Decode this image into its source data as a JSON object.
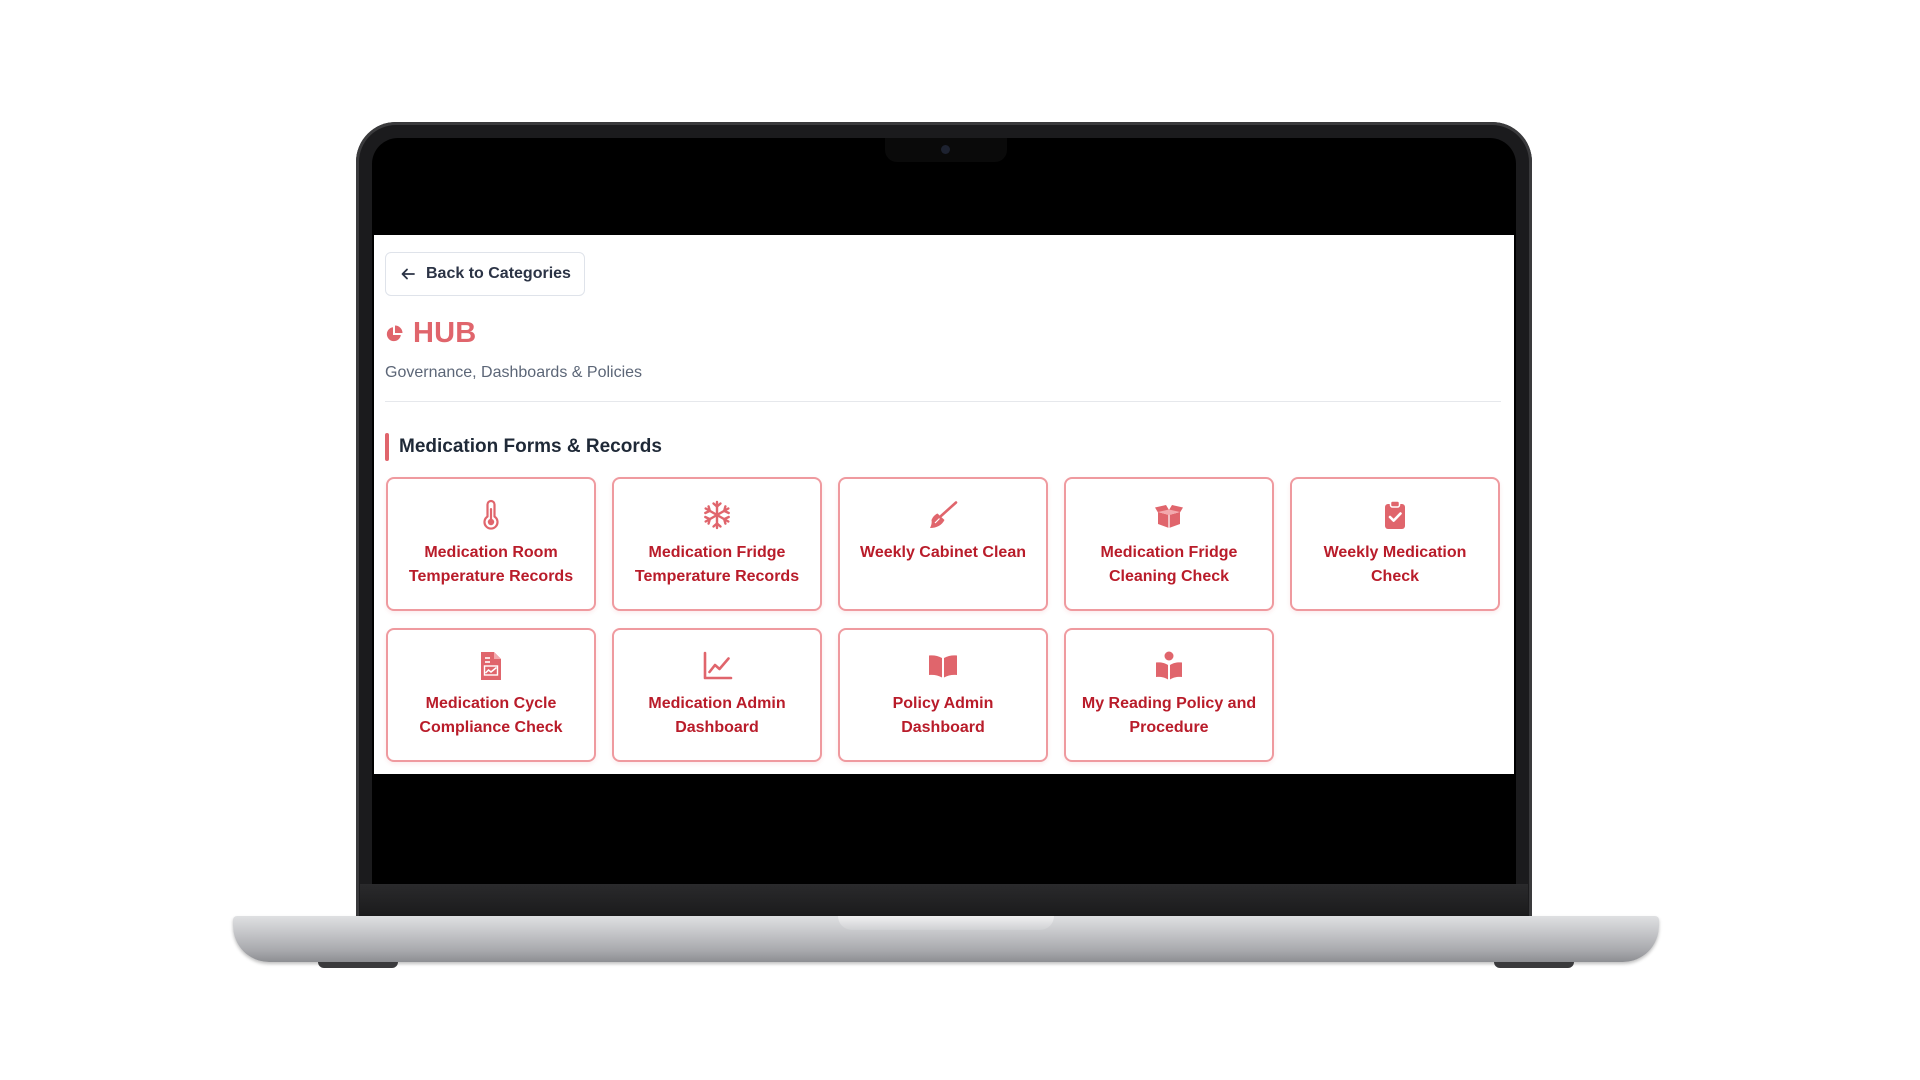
{
  "app": {
    "back_button_label": "Back to Categories",
    "title": "HUB",
    "subtitle": "Governance, Dashboards & Policies",
    "accent_color": "#e0656c",
    "card_text_color": "#b91c2a"
  },
  "section": {
    "heading": "Medication Forms & Records",
    "cards": [
      {
        "label": "Medication Room Temperature Records",
        "icon": "thermometer-icon"
      },
      {
        "label": "Medication Fridge Temperature Records",
        "icon": "snowflake-icon"
      },
      {
        "label": "Weekly Cabinet Clean",
        "icon": "broom-icon"
      },
      {
        "label": "Medication Fridge Cleaning Check",
        "icon": "open-box-icon"
      },
      {
        "label": "Weekly Medication Check",
        "icon": "clipboard-check-icon"
      },
      {
        "label": "Medication Cycle Compliance Check",
        "icon": "document-chart-icon"
      },
      {
        "label": "Medication Admin Dashboard",
        "icon": "line-chart-icon"
      },
      {
        "label": "Policy Admin Dashboard",
        "icon": "open-book-icon"
      },
      {
        "label": "My Reading Policy and Procedure",
        "icon": "book-reader-icon"
      }
    ]
  }
}
